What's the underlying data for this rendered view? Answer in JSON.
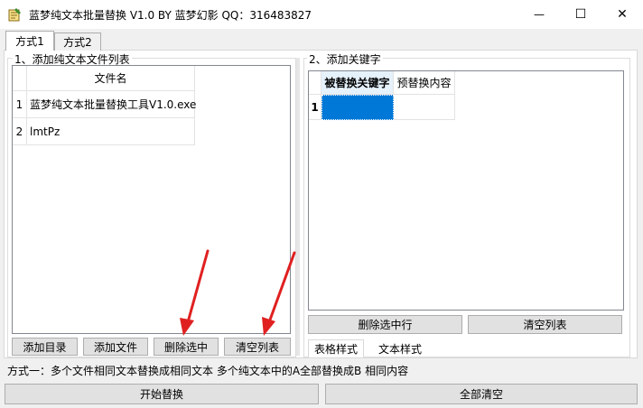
{
  "window": {
    "title": "蓝梦纯文本批量替换 V1.0 BY 蓝梦幻影 QQ：316483827",
    "min_label": "—",
    "max_label": "☐",
    "close_label": "✕"
  },
  "tabs": [
    {
      "label": "方式1",
      "active": true
    },
    {
      "label": "方式2",
      "active": false
    }
  ],
  "left_group": {
    "label": "1、添加纯文本文件列表",
    "column_header": "文件名",
    "rows": [
      {
        "num": "1",
        "name": "蓝梦纯文本批量替换工具V1.0.exe"
      },
      {
        "num": "2",
        "name": "lmtPz"
      }
    ],
    "buttons": {
      "add_dir": "添加目录",
      "add_file": "添加文件",
      "delete_selected": "删除选中",
      "clear_list": "清空列表"
    }
  },
  "right_group": {
    "label": "2、添加关键字",
    "headers": [
      "被替换关键字",
      "预替换内容"
    ],
    "rows": [
      {
        "num": "1",
        "keyword": "",
        "replacement": ""
      }
    ],
    "buttons": {
      "delete_selected_row": "删除选中行",
      "clear_list": "清空列表"
    },
    "subtabs": [
      "表格样式",
      "文本样式"
    ]
  },
  "description": "方式一：多个文件相同文本替换成相同文本   多个纯文本中的A全部替换成B 相同内容",
  "bottom_buttons": {
    "start": "开始替换",
    "clear_all": "全部清空"
  },
  "colors": {
    "selected_cell": "#0078d7",
    "annotation_arrow": "#e02020"
  }
}
